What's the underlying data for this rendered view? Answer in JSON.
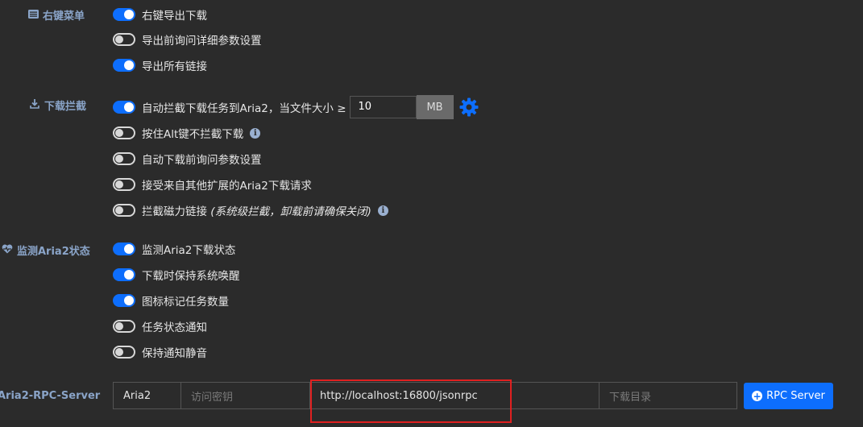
{
  "sections": {
    "context_menu": {
      "label": "右键菜单",
      "icon": "list-icon"
    },
    "download_intercept": {
      "label": "下载拦截",
      "icon": "download-icon"
    },
    "monitor": {
      "label": "监测Aria2状态",
      "icon": "heartbeat-icon"
    }
  },
  "context_menu": [
    {
      "label": "右键导出下载",
      "on": true
    },
    {
      "label": "导出前询问详细参数设置",
      "on": false
    },
    {
      "label": "导出所有链接",
      "on": true
    }
  ],
  "intercept": {
    "auto_label": "自动拦截下载任务到Aria2，当文件大小 ≥",
    "auto_on": true,
    "size_value": "10",
    "size_unit": "MB",
    "alt_label": "按住Alt键不拦截下载",
    "alt_on": false,
    "ask_label": "自动下载前询问参数设置",
    "ask_on": false,
    "accept_label": "接受来自其他扩展的Aria2下载请求",
    "accept_on": false,
    "magnet_label": "拦截磁力链接",
    "magnet_note": "(系统级拦截，卸载前请确保关闭)",
    "magnet_on": false
  },
  "monitor": [
    {
      "label": "监测Aria2下载状态",
      "on": true
    },
    {
      "label": "下载时保持系统唤醒",
      "on": true
    },
    {
      "label": "图标标记任务数量",
      "on": true
    },
    {
      "label": "任务状态通知",
      "on": false
    },
    {
      "label": "保持通知静音",
      "on": false
    }
  ],
  "rpc": {
    "label": "Aria2-RPC-Server",
    "name": "Aria2",
    "secret_placeholder": "访问密钥",
    "url": "http://localhost:16800/jsonrpc",
    "dir_placeholder": "下载目录",
    "button": "RPC Server"
  },
  "colors": {
    "accent": "#0d6efd",
    "highlight": "#e02020",
    "section_label": "#8aa4c8"
  }
}
